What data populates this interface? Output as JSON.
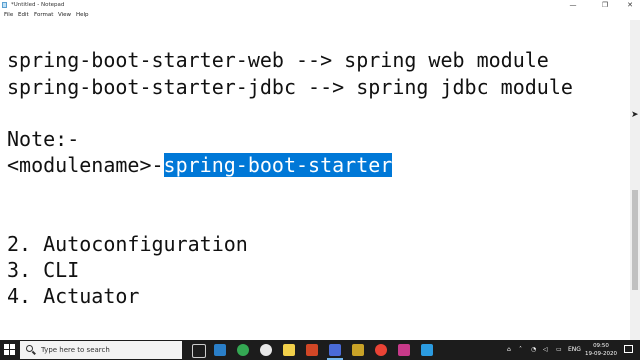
{
  "window": {
    "title": "*Untitled - Notepad",
    "minimize_glyph": "—",
    "maximize_glyph": "❐",
    "close_glyph": "✕"
  },
  "menu": {
    "items": [
      "File",
      "Edit",
      "Format",
      "View",
      "Help"
    ]
  },
  "editor": {
    "line1": "spring-boot-starter-web --> spring web module",
    "line2": "spring-boot-starter-jdbc --> spring jdbc module",
    "line3": "Note:-",
    "line4_prefix": "<modulename>-",
    "line4_selected": "spring-boot-starter",
    "line5": "2. Autoconfiguration",
    "line6": "3. CLI",
    "line7": "4. Actuator",
    "selection_color": "#0078d7"
  },
  "taskbar": {
    "search_placeholder": "Type here to search",
    "apps": [
      "task-view-icon",
      "virtualbox-icon",
      "chrome-icon",
      "steam-icon",
      "sticky-notes-icon",
      "file-explorer-icon",
      "powerpoint-icon",
      "notepad-icon",
      "chrome-icon",
      "settings-icon",
      "vscode-icon",
      "cloud-icon"
    ],
    "tray_language": "ENG",
    "time": "09:50",
    "date": "19-09-2020"
  }
}
